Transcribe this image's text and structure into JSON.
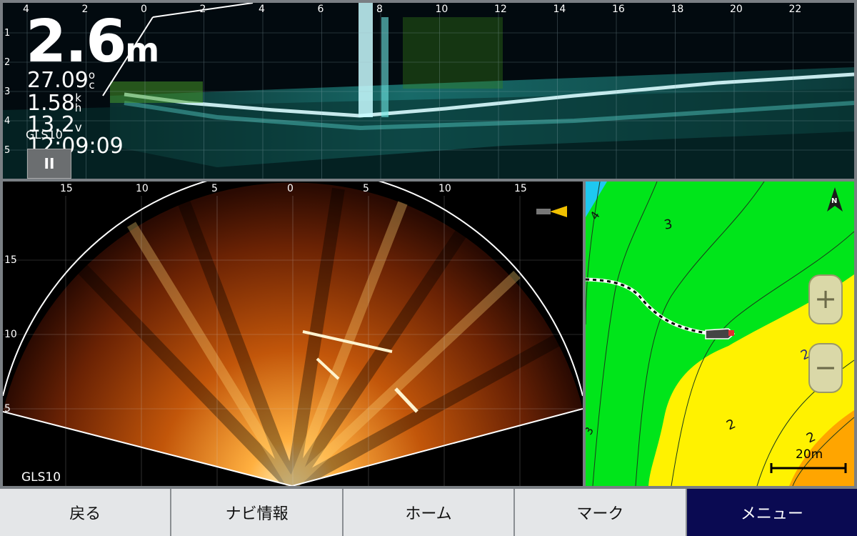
{
  "top_panel": {
    "range_labels": [
      "4",
      "2",
      "0",
      "2",
      "4",
      "6",
      "8",
      "10",
      "12",
      "14",
      "16",
      "18",
      "20",
      "22"
    ],
    "depth_labels": [
      "1",
      "2",
      "3",
      "4",
      "5"
    ],
    "depth_value": "2.6",
    "depth_unit": "m",
    "temperature_value": "27.09",
    "temperature_unit_top": "o",
    "temperature_unit_bottom": "c",
    "speed_value": "1.58",
    "speed_unit_top": "k",
    "speed_unit_bottom": "h",
    "voltage_value": "13.2",
    "voltage_unit": "v",
    "time": "12:09:09",
    "source": "GLS10",
    "pause_label": "II",
    "bg_color": "#020a0f",
    "sonar_color": "#4fe6e0"
  },
  "fan_panel": {
    "range_labels": [
      "15",
      "10",
      "5",
      "0",
      "5",
      "10",
      "15"
    ],
    "depth_labels": [
      "15",
      "10",
      "5"
    ],
    "source": "GLS10",
    "sonar_color": "#e07a10"
  },
  "map_panel": {
    "north_label": "N",
    "contour_labels": [
      "4",
      "3",
      "2",
      "2",
      "2",
      "3"
    ],
    "zoom_in_label": "+",
    "zoom_out_label": "−",
    "scale_label": "20m",
    "colors": {
      "shallow_green": "#00e51a",
      "yellow": "#fff200",
      "orange": "#ffa500",
      "water_blue": "#1ec8f0"
    }
  },
  "bottom_bar": {
    "buttons": [
      {
        "label": "戻る"
      },
      {
        "label": "ナビ情報"
      },
      {
        "label": "ホーム"
      },
      {
        "label": "マーク"
      },
      {
        "label": "メニュー"
      }
    ]
  }
}
